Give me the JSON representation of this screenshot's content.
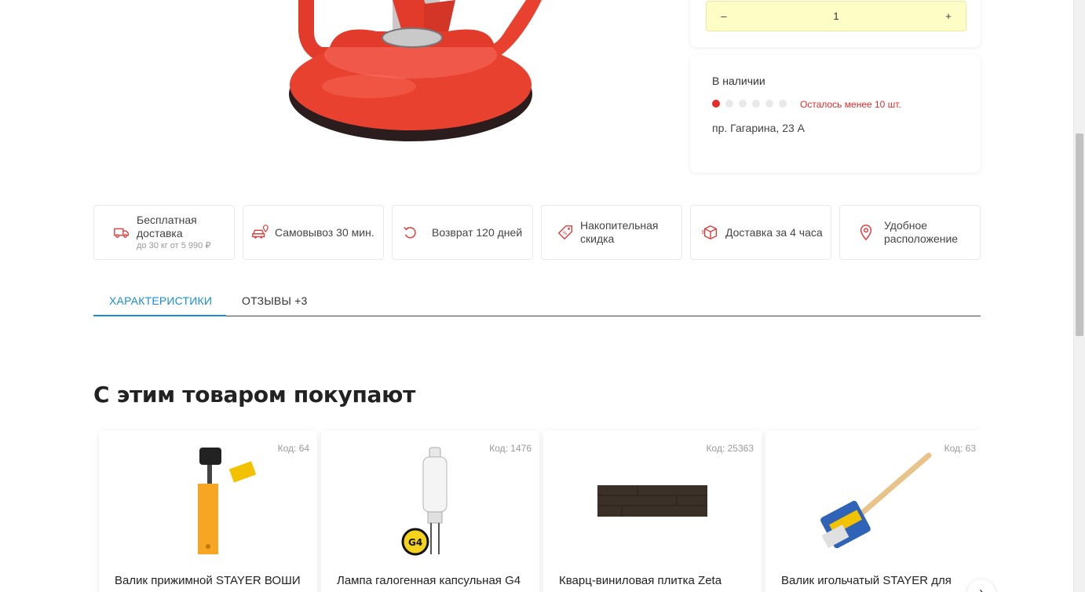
{
  "quantity": {
    "minus": "–",
    "value": "1",
    "plus": "+"
  },
  "stock": {
    "title": "В наличии",
    "level_filled": 1,
    "level_total": 6,
    "note": "Осталось менее 10 шт.",
    "address": "пр. Гагарина, 23 А"
  },
  "features": [
    {
      "icon": "truck-icon",
      "title": "Бесплатная доставка",
      "subtitle": "до 30 кг от 5 990 ₽"
    },
    {
      "icon": "car-location-icon",
      "title": "Самовывоз 30 мин."
    },
    {
      "icon": "return-icon",
      "title": "Возврат 120 дней"
    },
    {
      "icon": "discount-tag-icon",
      "title": "Накопительная скидка"
    },
    {
      "icon": "box-delivery-icon",
      "title": "Доставка за 4 часа"
    },
    {
      "icon": "map-pin-icon",
      "title": "Удобное расположение"
    }
  ],
  "tabs": [
    {
      "label": "ХАРАКТЕРИСТИКИ",
      "active": true
    },
    {
      "label": "ОТЗЫВЫ +3",
      "active": false
    }
  ],
  "related": {
    "title": "С этим товаром покупают",
    "products": [
      {
        "code": "Код: 64",
        "name": "Валик прижимной STAYER ВОШИ",
        "image": "roller-icon"
      },
      {
        "code": "Код: 1476",
        "name": "Лампа галогенная капсульная G4",
        "image": "halogen-lamp-icon"
      },
      {
        "code": "Код: 25363",
        "name": "Кварц-виниловая плитка Zeta",
        "image": "vinyl-tile-icon"
      },
      {
        "code": "Код: 63",
        "name": "Валик игольчатый STAYER для",
        "image": "needle-roller-icon"
      }
    ],
    "next_arrow": "›"
  },
  "colors": {
    "accent_blue": "#1a8ed6",
    "stock_red": "#e62b2b",
    "qty_bg": "#fffdc6",
    "icon_red": "#e23b3b"
  }
}
